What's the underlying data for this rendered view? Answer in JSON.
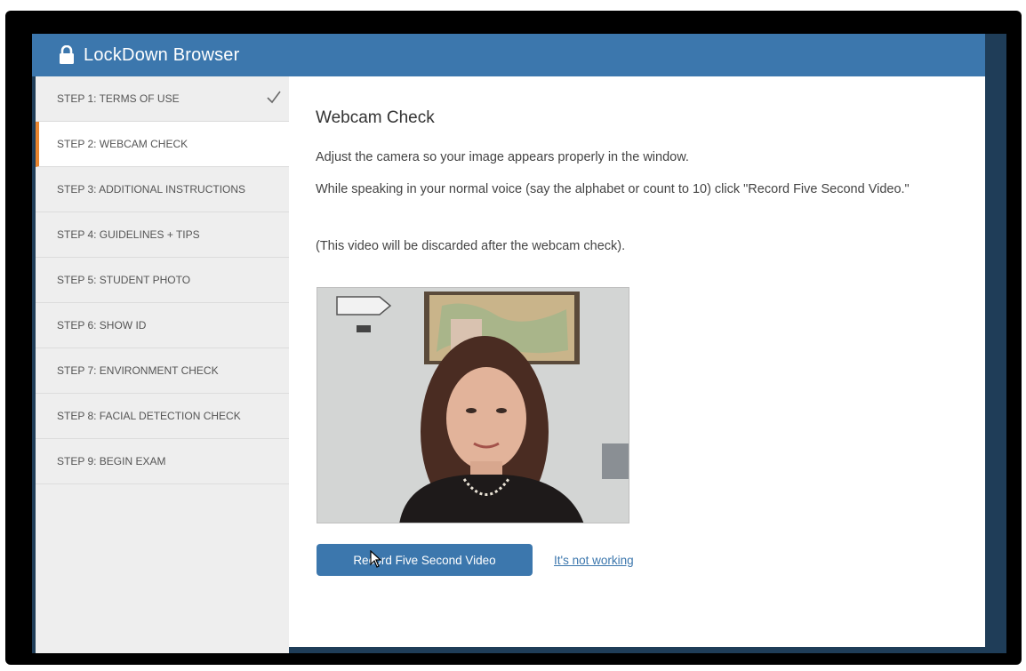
{
  "app": {
    "title": "LockDown Browser"
  },
  "sidebar": {
    "steps": [
      {
        "label": "STEP 1: TERMS OF USE",
        "completed": true
      },
      {
        "label": "STEP 2: WEBCAM CHECK",
        "active": true
      },
      {
        "label": "STEP 3: ADDITIONAL INSTRUCTIONS"
      },
      {
        "label": "STEP 4: GUIDELINES + TIPS"
      },
      {
        "label": "STEP 5: STUDENT PHOTO"
      },
      {
        "label": "STEP 6: SHOW ID"
      },
      {
        "label": "STEP 7: ENVIRONMENT CHECK"
      },
      {
        "label": "STEP 8: FACIAL DETECTION CHECK"
      },
      {
        "label": "STEP 9: BEGIN EXAM"
      }
    ]
  },
  "main": {
    "heading": "Webcam Check",
    "instruction1": "Adjust the camera so your image appears properly in the window.",
    "instruction2": "While speaking in your normal voice (say the alphabet or count to 10) click \"Record Five Second Video.\"",
    "instruction3": "(This video will be discarded after the webcam check).",
    "record_button": "Record Five Second Video",
    "not_working_link": "It's not working"
  },
  "colors": {
    "accent": "#3c77ad",
    "active_step": "#e8852f",
    "frame": "#1f3d58"
  },
  "icons": {
    "title": "lock-icon",
    "step_done": "checkmark-icon",
    "pointer": "mouse-cursor-icon"
  }
}
